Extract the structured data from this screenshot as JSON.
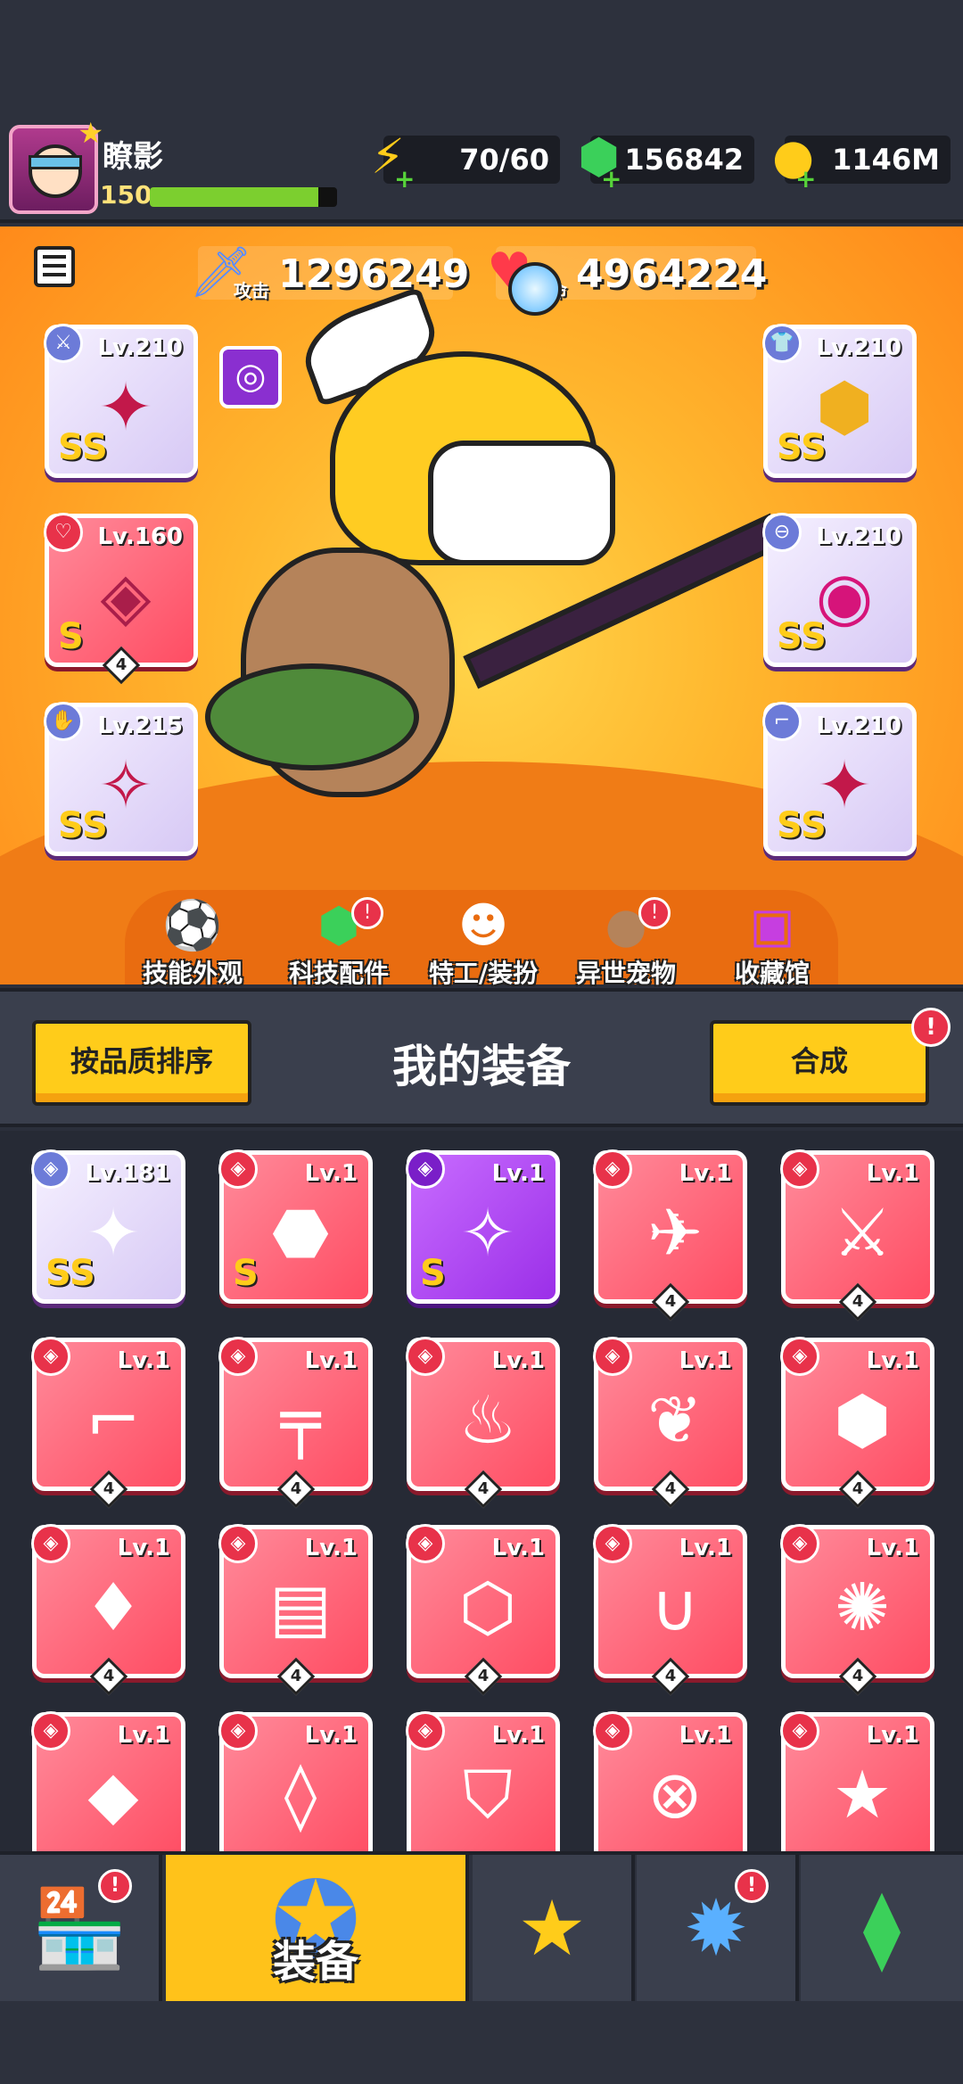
{
  "player": {
    "name": "瞭影",
    "level": "150",
    "xp_fraction": 0.9
  },
  "resources": {
    "energy": "70/60",
    "gems": "156842",
    "coins": "1146M"
  },
  "stats": {
    "attack_label": "攻击",
    "attack_value": "1296249",
    "hp_label": "生命",
    "hp_value": "4964224"
  },
  "equipped": {
    "left": [
      {
        "level": "Lv.210",
        "grade": "SS"
      },
      {
        "level": "Lv.160",
        "grade": "S",
        "stars": "4"
      },
      {
        "level": "Lv.215",
        "grade": "SS"
      }
    ],
    "right": [
      {
        "level": "Lv.210",
        "grade": "SS"
      },
      {
        "level": "Lv.210",
        "grade": "SS"
      },
      {
        "level": "Lv.210",
        "grade": "SS"
      }
    ]
  },
  "shortcuts": [
    {
      "label": "技能外观"
    },
    {
      "label": "科技配件",
      "badge": "!"
    },
    {
      "label": "特工/装扮"
    },
    {
      "label": "异世宠物",
      "badge": "!"
    },
    {
      "label": "收藏馆"
    }
  ],
  "toolbar": {
    "sort_label": "按品质排序",
    "title": "我的装备",
    "merge_label": "合成",
    "merge_badge": "!"
  },
  "inventory": [
    {
      "level": "Lv.181",
      "grade": "SS",
      "style": "ss",
      "icon": "necklace"
    },
    {
      "level": "Lv.1",
      "grade": "S",
      "style": "red",
      "icon": "armor"
    },
    {
      "level": "Lv.1",
      "grade": "S",
      "style": "purple",
      "icon": "gauntlet"
    },
    {
      "level": "Lv.1",
      "stars": "4",
      "style": "red",
      "icon": "kunai"
    },
    {
      "level": "Lv.1",
      "stars": "4",
      "style": "red",
      "icon": "sword"
    },
    {
      "level": "Lv.1",
      "stars": "4",
      "style": "red",
      "icon": "revolver"
    },
    {
      "level": "Lv.1",
      "stars": "4",
      "style": "red",
      "icon": "shotgun"
    },
    {
      "level": "Lv.1",
      "stars": "4",
      "style": "red",
      "icon": "torch"
    },
    {
      "level": "Lv.1",
      "stars": "4",
      "style": "red",
      "icon": "leaf-armor"
    },
    {
      "level": "Lv.1",
      "stars": "4",
      "style": "red",
      "icon": "plate-armor"
    },
    {
      "level": "Lv.1",
      "stars": "4",
      "style": "red",
      "icon": "chest-armor"
    },
    {
      "level": "Lv.1",
      "stars": "4",
      "style": "red",
      "icon": "robot-armor"
    },
    {
      "level": "Lv.1",
      "stars": "4",
      "style": "red",
      "icon": "steel-armor"
    },
    {
      "level": "Lv.1",
      "stars": "4",
      "style": "red",
      "icon": "fang-necklace"
    },
    {
      "level": "Lv.1",
      "stars": "4",
      "style": "red",
      "icon": "spiked-collar"
    },
    {
      "level": "Lv.1",
      "style": "red",
      "icon": "gem-ring"
    },
    {
      "level": "Lv.1",
      "style": "red",
      "icon": "pendant"
    },
    {
      "level": "Lv.1",
      "style": "red",
      "icon": "shield-pendant"
    },
    {
      "level": "Lv.1",
      "style": "red",
      "icon": "rope-belt"
    },
    {
      "level": "Lv.1",
      "style": "red",
      "icon": "star-belt"
    }
  ],
  "nav": [
    {
      "name": "shop",
      "badge": "!"
    },
    {
      "name": "equipment",
      "label": "装备"
    },
    {
      "name": "battle"
    },
    {
      "name": "talent",
      "badge": "!"
    },
    {
      "name": "gene"
    }
  ]
}
